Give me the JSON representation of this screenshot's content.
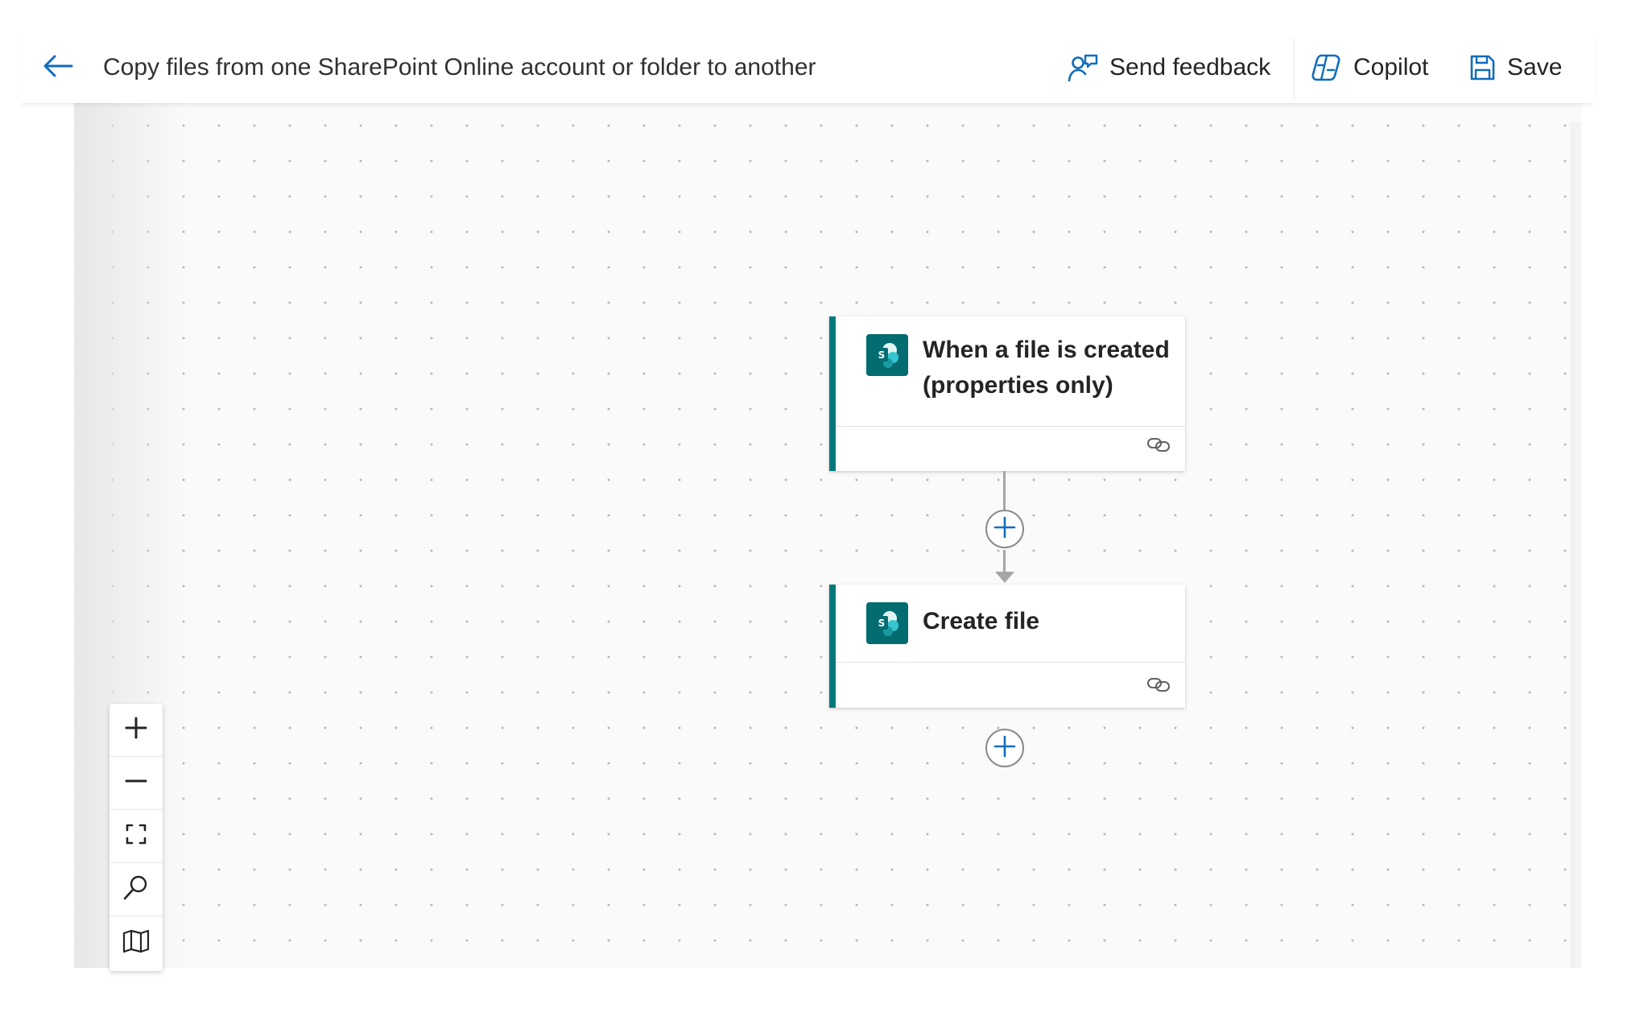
{
  "header": {
    "title": "Copy files from one SharePoint Online account or folder to another",
    "back_icon": "arrow-left-icon",
    "actions": [
      {
        "label": "Send feedback",
        "icon": "person-feedback-icon"
      },
      {
        "label": "Copilot",
        "icon": "copilot-icon"
      },
      {
        "label": "Save",
        "icon": "save-icon"
      }
    ]
  },
  "flow": {
    "steps": [
      {
        "title": "When a file is created (properties only)",
        "connector_icon": "sharepoint-icon",
        "status_icon": "link-icon"
      },
      {
        "title": "Create file",
        "connector_icon": "sharepoint-icon",
        "status_icon": "link-icon"
      }
    ],
    "add_step_icon": "plus-circle-icon"
  },
  "canvas_controls": [
    {
      "name": "zoom-in",
      "icon": "plus-icon"
    },
    {
      "name": "zoom-out",
      "icon": "minus-icon"
    },
    {
      "name": "fit-view",
      "icon": "fit-screen-icon"
    },
    {
      "name": "search",
      "icon": "search-icon"
    },
    {
      "name": "minimap",
      "icon": "map-icon"
    }
  ],
  "colors": {
    "accent": "#0f6cbd",
    "sharepoint": "#036c70",
    "card_border": "#03787c",
    "connector": "#a6a6a6"
  }
}
